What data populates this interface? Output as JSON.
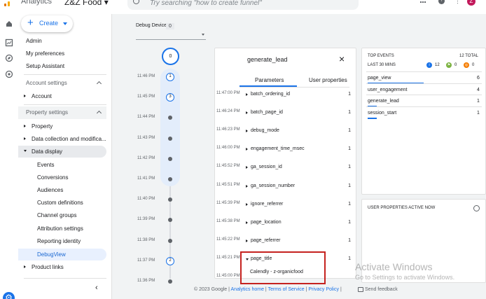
{
  "topbar": {
    "app_title": "Analytics",
    "account_name": "Z&Z Food",
    "search_placeholder": "Try searching \"how to create funnel\"",
    "avatar_letter": "Z",
    "help_glyph": "?",
    "more_glyph": "⋮"
  },
  "sidebar": {
    "create_label": "Create",
    "items": [
      "Admin",
      "My preferences",
      "Setup Assistant"
    ],
    "account_settings": {
      "header": "Account settings",
      "items": [
        "Account"
      ]
    },
    "property_settings": {
      "header": "Property settings",
      "items": [
        "Property",
        "Data collection and modifica...",
        "Data display"
      ],
      "data_display_children": [
        "Events",
        "Conversions",
        "Audiences",
        "Custom definitions",
        "Channel groups",
        "Attribution settings",
        "Reporting identity",
        "DebugView"
      ]
    },
    "product_links": "Product links",
    "collapse_glyph": "‹"
  },
  "debug_device": {
    "label": "Debug Device",
    "count": "0"
  },
  "timeline": {
    "top_count": "0",
    "times": [
      "11:46 PM",
      "11:45 PM",
      "11:44 PM",
      "11:43 PM",
      "11:42 PM",
      "11:41 PM",
      "11:40 PM",
      "11:39 PM",
      "11:38 PM",
      "11:37 PM",
      "11:36 PM"
    ],
    "counts": [
      "1",
      "3",
      "",
      "",
      "",
      "",
      "",
      "",
      "",
      "2",
      ""
    ]
  },
  "event_panel": {
    "title": "generate_lead",
    "close_glyph": "×",
    "tabs": [
      "Parameters",
      "User properties"
    ],
    "times": [
      "11:47:00 PM",
      "11:46:24 PM",
      "11:46:23 PM",
      "11:46:00 PM",
      "11:45:52 PM",
      "11:45:51 PM",
      "11:45:39 PM",
      "11:45:38 PM",
      "11:45:22 PM",
      "11:45:21 PM",
      "11:45:00 PM"
    ],
    "params": [
      {
        "name": "batch_ordering_id",
        "count": "1"
      },
      {
        "name": "batch_page_id",
        "count": "1"
      },
      {
        "name": "debug_mode",
        "count": "1"
      },
      {
        "name": "engagement_time_msec",
        "count": "1"
      },
      {
        "name": "ga_session_id",
        "count": "1"
      },
      {
        "name": "ga_session_number",
        "count": "1"
      },
      {
        "name": "ignore_referrer",
        "count": "1"
      },
      {
        "name": "page_location",
        "count": "1"
      },
      {
        "name": "page_referrer",
        "count": "1"
      },
      {
        "name": "page_title",
        "count": "1"
      }
    ],
    "expanded_value": "Calendly - z-organicfood"
  },
  "top_events": {
    "title": "TOP EVENTS",
    "total": "12 TOTAL",
    "subtitle": "LAST 30 MINS",
    "badges": [
      {
        "label": "12",
        "color": "#1a73e8",
        "glyph": "i"
      },
      {
        "label": "0",
        "color": "#7cb342",
        "glyph": "⚑"
      },
      {
        "label": "0",
        "color": "#f57c00",
        "glyph": "◎"
      }
    ],
    "events": [
      {
        "name": "page_view",
        "count": "6",
        "share": 0.5
      },
      {
        "name": "user_engagement",
        "count": "4",
        "share": 0.333
      },
      {
        "name": "generate_lead",
        "count": "1",
        "share": 0.083
      },
      {
        "name": "session_start",
        "count": "1",
        "share": 0.083
      }
    ]
  },
  "user_properties": {
    "title": "USER PROPERTIES ACTIVE NOW"
  },
  "footer": {
    "copyright": "© 2023 Google | ",
    "home": "Analytics home",
    "sep1": " | ",
    "tos": "Terms of Service",
    "sep2": " | ",
    "privacy": "Privacy Policy",
    "sep3": " | ",
    "feedback": "Send feedback"
  },
  "watermark": {
    "line1": "Activate Windows",
    "line2": "Go to Settings to activate Windows."
  },
  "colors": {
    "accent": "#1a73e8",
    "highlight_box": "#c5221f",
    "selected_bg": "#e8f0fe"
  }
}
